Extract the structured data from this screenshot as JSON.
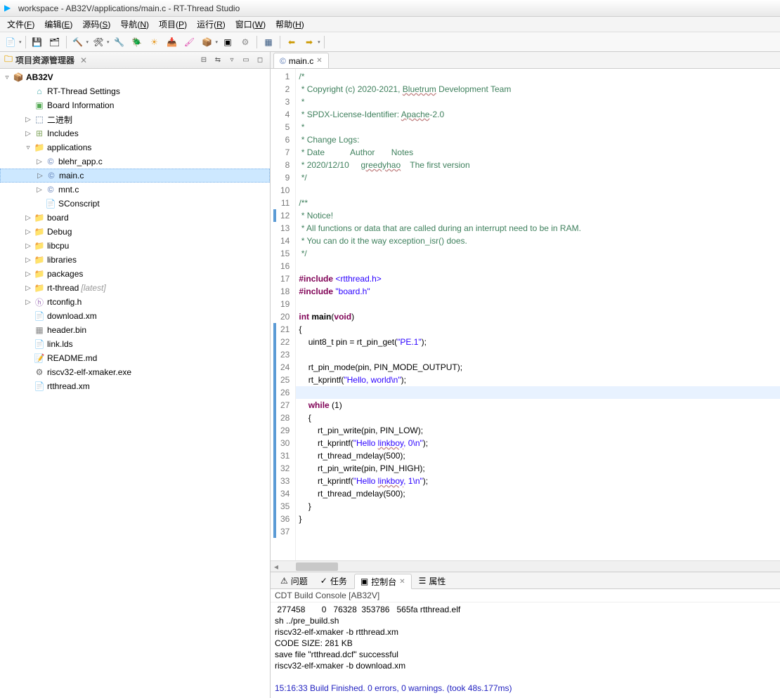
{
  "title": "workspace - AB32V/applications/main.c - RT-Thread Studio",
  "menus": [
    {
      "label": "文件",
      "key": "F"
    },
    {
      "label": "编辑",
      "key": "E"
    },
    {
      "label": "源码",
      "key": "S"
    },
    {
      "label": "导航",
      "key": "N"
    },
    {
      "label": "项目",
      "key": "P"
    },
    {
      "label": "运行",
      "key": "R"
    },
    {
      "label": "窗口",
      "key": "W"
    },
    {
      "label": "帮助",
      "key": "H"
    }
  ],
  "explorer": {
    "title": "项目资源管理器",
    "close": "✕",
    "root": "AB32V",
    "items": [
      {
        "label": "RT-Thread Settings",
        "icon": "rt",
        "indent": 2
      },
      {
        "label": "Board Information",
        "icon": "board",
        "indent": 2
      },
      {
        "label": "二进制",
        "icon": "bin",
        "indent": 2,
        "toggle": "▷"
      },
      {
        "label": "Includes",
        "icon": "inc",
        "indent": 2,
        "toggle": "▷"
      },
      {
        "label": "applications",
        "icon": "folder",
        "indent": 2,
        "toggle": "▿",
        "open": true
      },
      {
        "label": "blehr_app.c",
        "icon": "c",
        "indent": 3,
        "toggle": "▷"
      },
      {
        "label": "main.c",
        "icon": "c",
        "indent": 3,
        "toggle": "▷",
        "selected": true
      },
      {
        "label": "mnt.c",
        "icon": "c",
        "indent": 3,
        "toggle": "▷"
      },
      {
        "label": "SConscript",
        "icon": "txt",
        "indent": 3
      },
      {
        "label": "board",
        "icon": "folder",
        "indent": 2,
        "toggle": "▷"
      },
      {
        "label": "Debug",
        "icon": "folder",
        "indent": 2,
        "toggle": "▷"
      },
      {
        "label": "libcpu",
        "icon": "folder",
        "indent": 2,
        "toggle": "▷"
      },
      {
        "label": "libraries",
        "icon": "folder",
        "indent": 2,
        "toggle": "▷"
      },
      {
        "label": "packages",
        "icon": "folder",
        "indent": 2,
        "toggle": "▷"
      },
      {
        "label": "rt-thread",
        "icon": "folder",
        "indent": 2,
        "toggle": "▷",
        "suffix": "[latest]"
      },
      {
        "label": "rtconfig.h",
        "icon": "h",
        "indent": 2,
        "toggle": "▷"
      },
      {
        "label": "download.xm",
        "icon": "txt",
        "indent": 2
      },
      {
        "label": "header.bin",
        "icon": "bin2",
        "indent": 2
      },
      {
        "label": "link.lds",
        "icon": "txt",
        "indent": 2
      },
      {
        "label": "README.md",
        "icon": "md",
        "indent": 2
      },
      {
        "label": "riscv32-elf-xmaker.exe",
        "icon": "exe",
        "indent": 2
      },
      {
        "label": "rtthread.xm",
        "icon": "txt",
        "indent": 2
      }
    ]
  },
  "editor": {
    "tab": "main.c",
    "lines": [
      {
        "n": 1,
        "html": "<span class='cm'>/*</span>"
      },
      {
        "n": 2,
        "html": "<span class='cm'> * Copyright (c) 2020-2021, <span class='und'>Bluetrum</span> Development Team</span>"
      },
      {
        "n": 3,
        "html": "<span class='cm'> *</span>"
      },
      {
        "n": 4,
        "html": "<span class='cm'> * SPDX-License-Identifier: <span class='und'>Apache</span>-2.0</span>"
      },
      {
        "n": 5,
        "html": "<span class='cm'> *</span>"
      },
      {
        "n": 6,
        "html": "<span class='cm'> * Change Logs:</span>"
      },
      {
        "n": 7,
        "html": "<span class='cm'> * Date           Author       Notes</span>"
      },
      {
        "n": 8,
        "html": "<span class='cm'> * 2020/12/10     <span class='und'>greedyhao</span>    The first version</span>"
      },
      {
        "n": 9,
        "html": "<span class='cm'> */</span>"
      },
      {
        "n": 10,
        "html": ""
      },
      {
        "n": 11,
        "html": "<span class='cm'>/**</span>",
        "fold": true
      },
      {
        "n": 12,
        "html": "<span class='cm'> * Notice!</span>"
      },
      {
        "n": 13,
        "html": "<span class='cm'> * All functions or data that are called during an interrupt need to be in RAM.</span>"
      },
      {
        "n": 14,
        "html": "<span class='cm'> * You can do it the way exception_isr() does.</span>"
      },
      {
        "n": 15,
        "html": "<span class='cm'> */</span>"
      },
      {
        "n": 16,
        "html": ""
      },
      {
        "n": 17,
        "html": "<span class='kw'>#include</span> <span class='inc'>&lt;rtthread.h&gt;</span>"
      },
      {
        "n": 18,
        "html": "<span class='kw'>#include</span> <span class='inc'>\"board.h\"</span>"
      },
      {
        "n": 19,
        "html": ""
      },
      {
        "n": 20,
        "html": "<span class='kw'>int</span> <span class='fn'>main</span>(<span class='kw'>void</span>)",
        "fold": true
      },
      {
        "n": 21,
        "html": "{",
        "fold": true
      },
      {
        "n": 22,
        "html": "    uint8_t pin = rt_pin_get(<span class='st'>\"PE.1\"</span>);",
        "fold": true
      },
      {
        "n": 23,
        "html": "",
        "fold": true
      },
      {
        "n": 24,
        "html": "    rt_pin_mode(pin, PIN_MODE_OUTPUT);",
        "fold": true
      },
      {
        "n": 25,
        "html": "    rt_kprintf(<span class='st'>\"Hello, world\\n\"</span>);",
        "fold": true
      },
      {
        "n": 26,
        "html": "",
        "fold": true,
        "hl": true
      },
      {
        "n": 27,
        "html": "    <span class='kw'>while</span> (1)",
        "fold": true
      },
      {
        "n": 28,
        "html": "    {",
        "fold": true
      },
      {
        "n": 29,
        "html": "        rt_pin_write(pin, PIN_LOW);",
        "fold": true
      },
      {
        "n": 30,
        "html": "        rt_kprintf(<span class='st'>\"Hello <span class='und'>linkboy</span>, 0\\n\"</span>);",
        "fold": true
      },
      {
        "n": 31,
        "html": "        rt_thread_mdelay(500);",
        "fold": true
      },
      {
        "n": 32,
        "html": "        rt_pin_write(pin, PIN_HIGH);",
        "fold": true
      },
      {
        "n": 33,
        "html": "        rt_kprintf(<span class='st'>\"Hello <span class='und'>linkboy</span>, 1\\n\"</span>);",
        "fold": true
      },
      {
        "n": 34,
        "html": "        rt_thread_mdelay(500);",
        "fold": true
      },
      {
        "n": 35,
        "html": "    }",
        "fold": true
      },
      {
        "n": 36,
        "html": "}",
        "fold": true
      },
      {
        "n": 37,
        "html": ""
      }
    ]
  },
  "bottomTabs": [
    {
      "label": "问题",
      "icon": "⚠"
    },
    {
      "label": "任务",
      "icon": "✓"
    },
    {
      "label": "控制台",
      "icon": "▣",
      "active": true
    },
    {
      "label": "属性",
      "icon": "☰"
    }
  ],
  "console": {
    "title": "CDT Build Console [AB32V]",
    "lines": [
      {
        "t": " 277458       0   76328  353786   565fa rtthread.elf"
      },
      {
        "t": "sh ../pre_build.sh"
      },
      {
        "t": "riscv32-elf-xmaker -b rtthread.xm"
      },
      {
        "t": "CODE SIZE: 281 KB"
      },
      {
        "t": "save file \"rtthread.dcf\" successful"
      },
      {
        "t": "riscv32-elf-xmaker -b download.xm"
      },
      {
        "t": ""
      },
      {
        "t": "15:16:33 Build Finished. 0 errors, 0 warnings. (took 48s.177ms)",
        "ok": true
      }
    ]
  }
}
